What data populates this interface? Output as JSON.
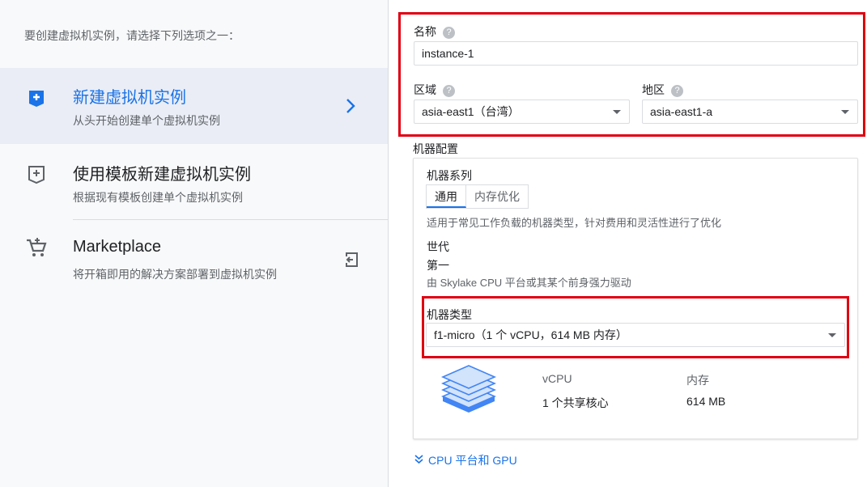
{
  "left": {
    "intro": "要创建虚拟机实例，请选择下列选项之一：",
    "options": [
      {
        "title": "新建虚拟机实例",
        "subtitle": "从头开始创建单个虚拟机实例"
      },
      {
        "title": "使用模板新建虚拟机实例",
        "subtitle": "根据现有模板创建单个虚拟机实例"
      },
      {
        "title": "Marketplace",
        "subtitle": "将开箱即用的解决方案部署到虚拟机实例"
      }
    ]
  },
  "form": {
    "name_label": "名称",
    "name_value": "instance-1",
    "region_label": "区域",
    "region_value": "asia-east1（台湾）",
    "zone_label": "地区",
    "zone_value": "asia-east1-a",
    "help_glyph": "?"
  },
  "machine": {
    "section_label": "机器配置",
    "family_label": "机器系列",
    "tabs": [
      "通用",
      "内存优化"
    ],
    "family_desc": "适用于常见工作负载的机器类型，针对费用和灵活性进行了优化",
    "generation_label": "世代",
    "generation_value": "第一",
    "generation_desc": "由 Skylake CPU 平台或其某个前身强力驱动",
    "type_label": "机器类型",
    "type_value": "f1-micro（1 个 vCPU，614 MB 内存）",
    "vcpu_label": "vCPU",
    "vcpu_value": "1 个共享核心",
    "memory_label": "内存",
    "memory_value": "614 MB",
    "cpu_gpu_link": "CPU 平台和 GPU"
  },
  "colors": {
    "accent": "#1a73e8",
    "highlight_border": "#e0000f"
  }
}
